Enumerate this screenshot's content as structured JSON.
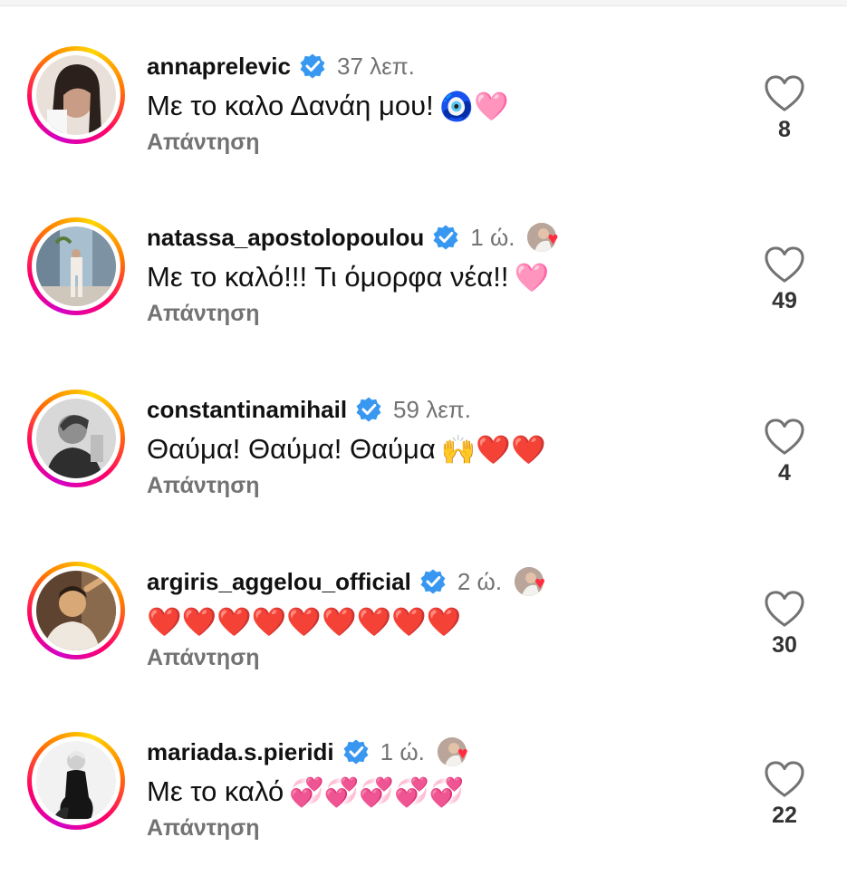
{
  "comments": [
    {
      "username": "annaprelevic",
      "time": "37 λεπ.",
      "text": "Με το καλο Δανάη μου!",
      "emoji": "🧿🩷",
      "reply": "Απάντηση",
      "likes": "8",
      "liked_by_author": false,
      "avatar_palette": [
        "#e9e1d9",
        "#2b201b"
      ]
    },
    {
      "username": "natassa_apostolopoulou",
      "time": "1 ώ.",
      "text": "Με το καλό!!! Τι όμορφα νέα!!",
      "emoji": "🩷",
      "reply": "Απάντηση",
      "likes": "49",
      "liked_by_author": true,
      "avatar_palette": [
        "#8fa7b8",
        "#e7e1d8"
      ]
    },
    {
      "username": "constantinamihail",
      "time": "59 λεπ.",
      "text": "Θαύμα! Θαύμα! Θαύμα",
      "emoji": "🙌❤️❤️",
      "reply": "Απάντηση",
      "likes": "4",
      "liked_by_author": false,
      "avatar_palette": [
        "#d7d7d7",
        "#3a3a3a"
      ]
    },
    {
      "username": "argiris_aggelou_official",
      "time": "2 ώ.",
      "text": "",
      "emoji": "❤️❤️❤️❤️❤️❤️❤️❤️❤️",
      "reply": "Απάντηση",
      "likes": "30",
      "liked_by_author": true,
      "avatar_palette": [
        "#6b4b32",
        "#d9a877"
      ]
    },
    {
      "username": "mariada.s.pieridi",
      "time": "1 ώ.",
      "text": "Με το καλό",
      "emoji": "💞💞💞💞💞",
      "reply": "Απάντηση",
      "likes": "22",
      "liked_by_author": true,
      "avatar_palette": [
        "#f2f2f2",
        "#151515"
      ]
    }
  ],
  "colors": {
    "verified": "#3897f0",
    "muted_text": "#737373",
    "heart_red": "#e3132c"
  }
}
